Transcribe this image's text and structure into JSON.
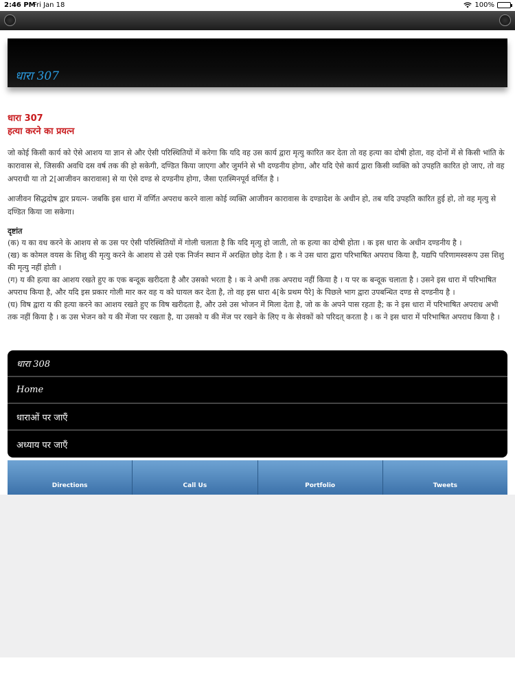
{
  "status": {
    "time": "2:46 PM",
    "date": "Fri Jan 18",
    "battery": "100%",
    "battery_level": 1.0
  },
  "header": {
    "title": "धारा 307"
  },
  "article": {
    "heading": "धारा 307",
    "subheading": "हत्या करने का प्रयत्न",
    "para1": "जो कोई किसी कार्य को ऐसे आशय या ज्ञान से और ऐसी परिस्थितियों में करेगा कि यदि वह उस कार्य द्वारा मृत्यु कारित कर देता तो वह हत्या का दोषी होता, वह दोनों में से किसी भांति के कारावास से, जिसकी अवधि दस वर्ष तक की हो सकेगी, दण्डित किया जाएगा और जुर्माने से भी दण्डनीय होगा, और यदि ऐसे कार्य द्वारा किसी व्यक्ति को उपहति कारित हो जाए, तो वह अपराधी या तो 2[आजीवन कारावास] से या ऐसे दण्ड से दण्डनीय होगा, जैसा एतस्मिनपूर्व वर्णित है ।",
    "para2": "आजीवन सिद्धदोष द्वार प्रयत्न- जबकि इस धारा में वर्णित अपराध करने वाला कोई व्यक्ति आजीवन कारावास के दण्डादेश के अधीन हो, तब यदि उपहति कारित हुई हो, तो वह मृत्यु से दण्डित किया जा सकेगा।",
    "examples_title": "दृष्टांत",
    "examples": [
      "(क) य का वध करने के आशय से क उस पर ऐसी परिस्थितियों में गोली चलाता है कि यदि मृत्यु हो जाती, तो क हत्या का दोषी होता । क इस धारा के अधीन दण्डनीय है ।",
      "(ख) क कोमल वयस के शिशु की मृत्यु करने के आशय से उसे एक निर्जन स्थान में अरक्षित छोड़ देता है । क ने उस धारा द्वारा परिभाषित अपराध किया है, यद्यपि परिणामस्वरूप उस शिशु की मृत्यु नहीं होती ।",
      "(ग) य की हत्या का आशय रखते हुए क एक बन्दूक खरीदता है और उसको भरता है । क ने अभी तक अपराध नहीं किया है । य पर क बन्दूक चलाता है । उसने इस धारा में परिभाषित अपराध किया है, और यदि इस प्रकार गोली मार कर वह य को घायल कर देता है, तो वह इस धारा 4[के प्रथम पैरे] के पिछले भाग द्वारा उपबन्धित दण्ड से दण्डनीय है ।",
      "(घ) विष द्वारा य की हत्या करने का आशय रखते हुए क विष खरीदता है, और उसे उस भोजन में मिला देता है, जो क के अपने पास रहता है; क ने इस धारा में परिभाषित अपराध अभी तक नहीं किया है । क उस भेजन को य की मेंजा पर रखता है, या उसको य की मेंज पर रखने के लिए य के सेवकों को परिदत् करता है । क ने इस धारा में परिभाषित अपराध किया है ।"
    ]
  },
  "menu": [
    {
      "label": "धारा 308"
    },
    {
      "label": "Home"
    },
    {
      "label": "धाराओं पर जाएँ"
    },
    {
      "label": "अध्याय पर जाएँ"
    }
  ],
  "tabs": [
    {
      "label": "Directions"
    },
    {
      "label": "Call Us"
    },
    {
      "label": "Portfolio"
    },
    {
      "label": "Tweets"
    }
  ],
  "icons": {
    "wifi": "wifi-icon",
    "battery": "battery-icon"
  }
}
